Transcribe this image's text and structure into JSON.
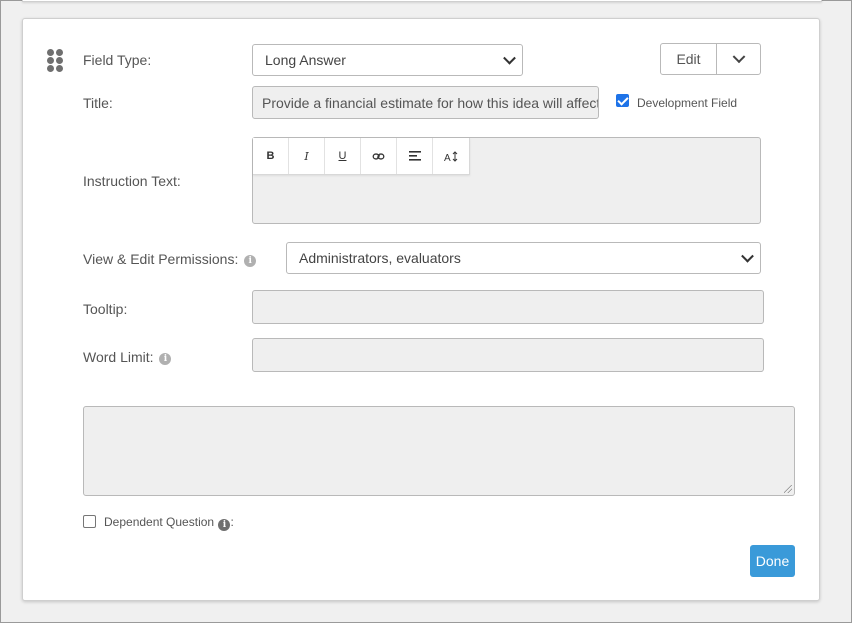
{
  "form": {
    "field_type": {
      "label": "Field Type:",
      "value": "Long Answer"
    },
    "edit_button": {
      "label": "Edit"
    },
    "title": {
      "label": "Title:",
      "value": "Provide a financial estimate for how this idea will affect c"
    },
    "development_field": {
      "label": "Development Field",
      "checked": true
    },
    "instruction_text": {
      "label": "Instruction Text:",
      "toolbar": [
        "bold",
        "italic",
        "underline",
        "link",
        "align",
        "text-size"
      ]
    },
    "permissions": {
      "label": "View & Edit Permissions:",
      "value": "Administrators, evaluators"
    },
    "tooltip": {
      "label": "Tooltip:",
      "value": ""
    },
    "word_limit": {
      "label": "Word Limit:",
      "value": ""
    },
    "dependent_question": {
      "label": "Dependent Question",
      "suffix": ":",
      "checked": false
    },
    "done_button": {
      "label": "Done"
    }
  },
  "colors": {
    "accent": "#3a9ad9",
    "checkbox_checked": "#1e73e8",
    "input_background": "#efefef"
  }
}
